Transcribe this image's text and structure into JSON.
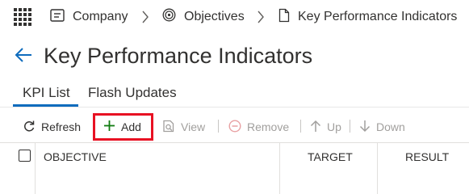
{
  "breadcrumb": {
    "items": [
      {
        "label": "Company",
        "icon": "building-icon"
      },
      {
        "label": "Objectives",
        "icon": "target-icon"
      },
      {
        "label": "Key Performance Indicators",
        "icon": "document-icon"
      }
    ]
  },
  "page": {
    "title": "Key Performance Indicators"
  },
  "tabs": [
    {
      "label": "KPI List",
      "selected": true
    },
    {
      "label": "Flash Updates",
      "selected": false
    }
  ],
  "toolbar": {
    "refresh_label": "Refresh",
    "add_label": "Add",
    "view_label": "View",
    "remove_label": "Remove",
    "up_label": "Up",
    "down_label": "Down"
  },
  "grid": {
    "columns": [
      "OBJECTIVE",
      "TARGET",
      "RESULT"
    ]
  },
  "colors": {
    "accent": "#0f6cbd",
    "add_icon": "#107c10",
    "remove_icon": "#d13438",
    "highlight_box": "#e81123",
    "disabled_text": "#a19f9d"
  }
}
